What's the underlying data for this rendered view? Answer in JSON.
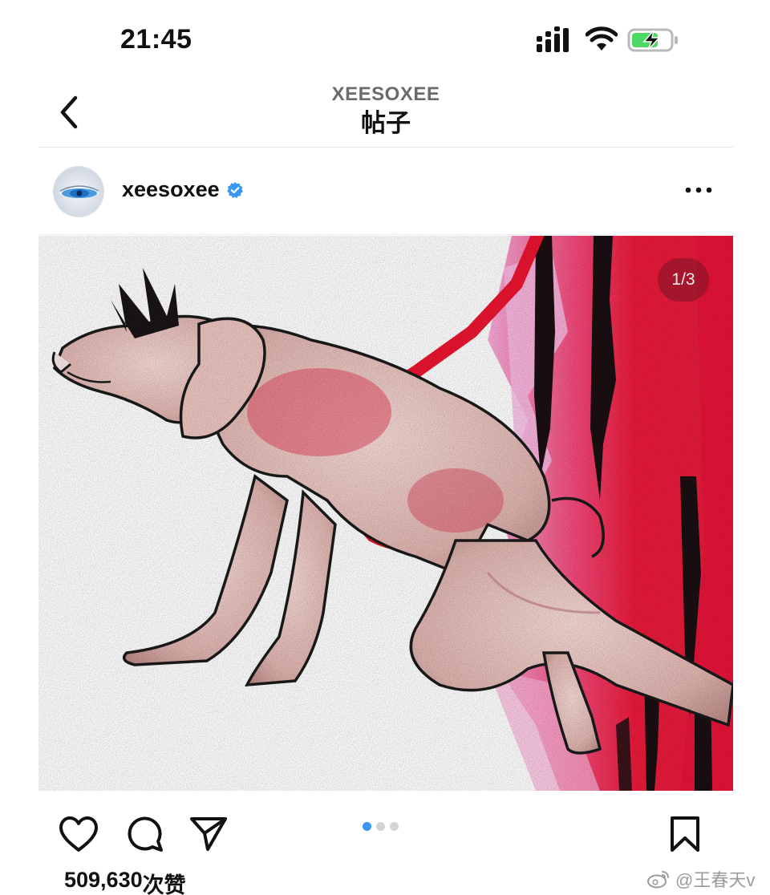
{
  "status_bar": {
    "time": "21:45",
    "icons": [
      "signal-bars-icon",
      "wifi-icon",
      "battery-charging-icon"
    ],
    "battery_color": "#4cd964"
  },
  "header": {
    "back_icon": "chevron-left-icon",
    "subtitle": "XEESOXEE",
    "title": "帖子"
  },
  "post": {
    "username": "xeesoxee",
    "verified": true,
    "verified_color": "#3897f0",
    "more_icon": "more-horizontal-icon",
    "media": {
      "page_indicator": "1/3",
      "total_pages": 3,
      "current_page": 1,
      "dot_active_color": "#3897f0",
      "accent_red": "#e8193a"
    },
    "actions": [
      "heart-icon",
      "comment-icon",
      "share-icon",
      "bookmark-icon"
    ],
    "likes_count": "509,630",
    "likes_suffix": "次赞"
  },
  "watermark": {
    "logo": "weibo-logo-icon",
    "text": "@王春天v"
  }
}
